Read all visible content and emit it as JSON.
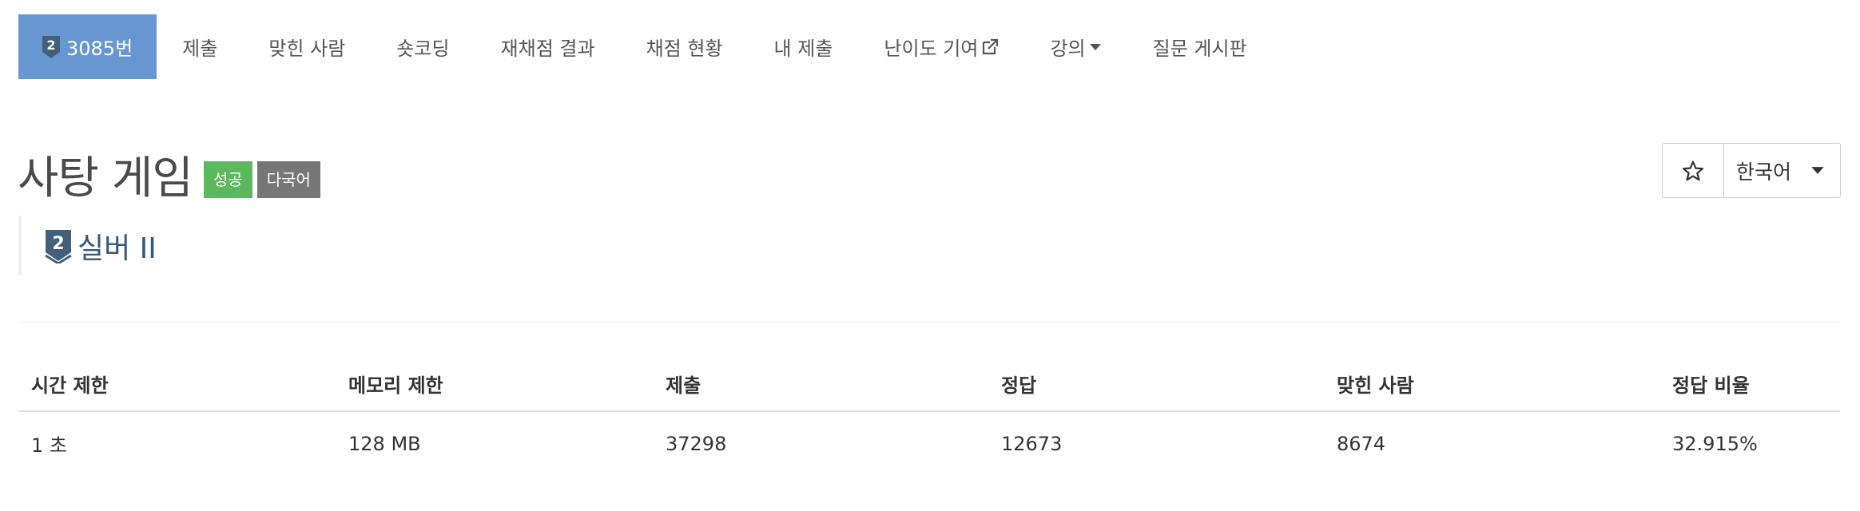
{
  "nav": {
    "problem_number": "3085번",
    "items": [
      {
        "label": "제출"
      },
      {
        "label": "맞힌 사람"
      },
      {
        "label": "숏코딩"
      },
      {
        "label": "재채점 결과"
      },
      {
        "label": "채점 현황"
      },
      {
        "label": "내 제출"
      },
      {
        "label": "난이도 기여"
      },
      {
        "label": "강의"
      },
      {
        "label": "질문 게시판"
      }
    ]
  },
  "problem": {
    "title": "사탕 게임",
    "labels": [
      {
        "text": "성공",
        "color": "#5cb85c"
      },
      {
        "text": "다국어",
        "color": "#777777"
      }
    ],
    "tier_number": "2",
    "tier": "실버 II"
  },
  "controls": {
    "star_icon": "star-outline-icon",
    "language": "한국어"
  },
  "info": {
    "headers": [
      "시간 제한",
      "메모리 제한",
      "제출",
      "정답",
      "맞힌 사람",
      "정답 비율"
    ],
    "values": [
      "1 초",
      "128 MB",
      "37298",
      "12673",
      "8674",
      "32.915%"
    ]
  },
  "colors": {
    "active_tab": "#6796d0",
    "tier_silver": "#435f7a",
    "success": "#5cb85c",
    "default": "#777777"
  }
}
